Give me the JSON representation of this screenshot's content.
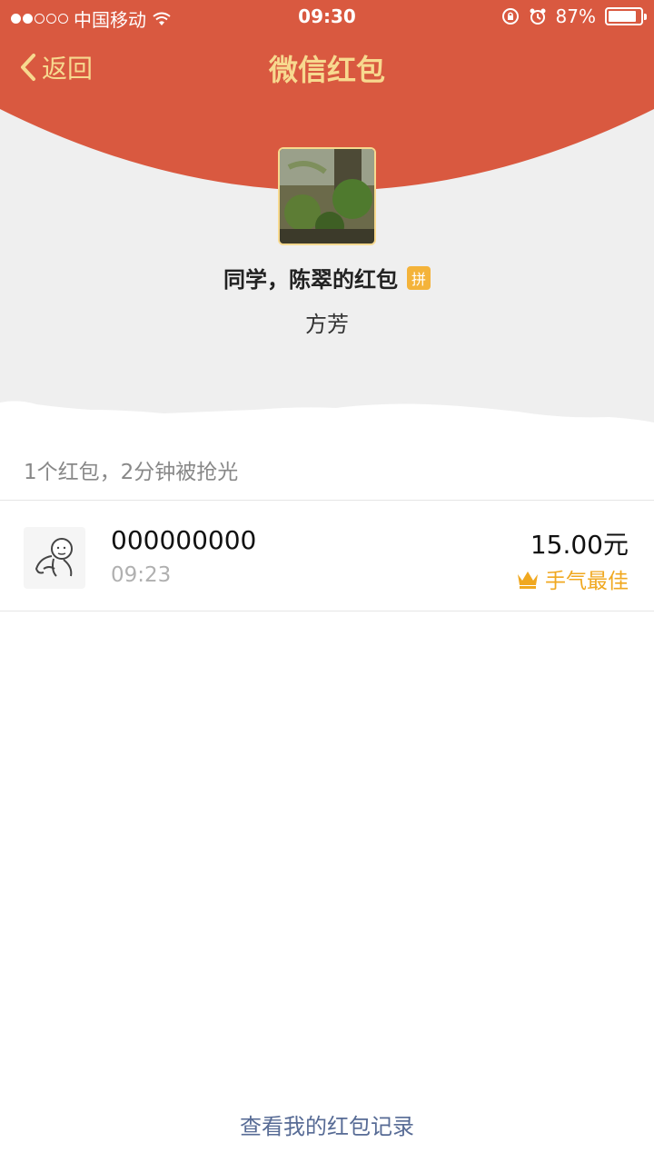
{
  "status_bar": {
    "carrier": "中国移动",
    "time": "09:30",
    "battery_percent": "87%",
    "battery_level": 0.87
  },
  "nav": {
    "back_label": "返回",
    "title": "微信红包"
  },
  "packet": {
    "title": "同学，陈翠的红包",
    "badge": "拼",
    "sender": "方芳"
  },
  "summary": "1个红包，2分钟被抢光",
  "records": [
    {
      "name": "000000000",
      "time": "09:23",
      "amount": "15.00元",
      "best_label": "手气最佳"
    }
  ],
  "footer": {
    "link": "查看我的红包记录"
  },
  "colors": {
    "header_red": "#d95940",
    "gold": "#f7d98f",
    "best_orange": "#f0a820",
    "link_blue": "#576b95",
    "badge_yellow": "#f4b33a"
  },
  "icons": [
    "signal-dots",
    "wifi-icon",
    "rotation-lock-icon",
    "alarm-icon",
    "battery-icon",
    "back-chevron-icon",
    "crown-icon"
  ]
}
